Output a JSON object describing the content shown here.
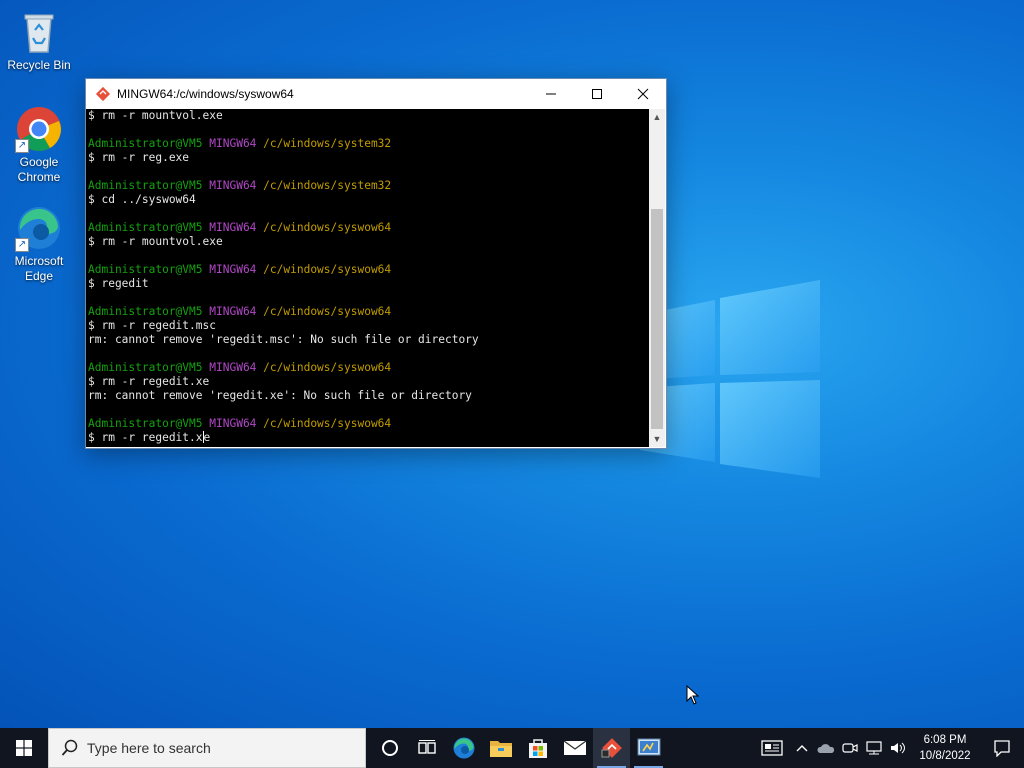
{
  "desktop": {
    "icons": [
      {
        "label": "Recycle Bin",
        "icon": "recycle-bin-icon"
      },
      {
        "label": "Google Chrome",
        "icon": "chrome-icon"
      },
      {
        "label": "Microsoft Edge",
        "icon": "edge-icon"
      }
    ]
  },
  "terminal": {
    "title": "MINGW64:/c/windows/syswow64",
    "user_host": "Administrator@VM5",
    "shell": "MINGW64",
    "lines": [
      {
        "kind": "cmd",
        "text": "$ rm -r mountvol.exe"
      },
      {
        "kind": "blank"
      },
      {
        "kind": "prompt",
        "path": "/c/windows/system32"
      },
      {
        "kind": "cmd",
        "text": "$ rm -r reg.exe"
      },
      {
        "kind": "blank"
      },
      {
        "kind": "prompt",
        "path": "/c/windows/system32"
      },
      {
        "kind": "cmd",
        "text": "$ cd ../syswow64"
      },
      {
        "kind": "blank"
      },
      {
        "kind": "prompt",
        "path": "/c/windows/syswow64"
      },
      {
        "kind": "cmd",
        "text": "$ rm -r mountvol.exe"
      },
      {
        "kind": "blank"
      },
      {
        "kind": "prompt",
        "path": "/c/windows/syswow64"
      },
      {
        "kind": "cmd",
        "text": "$ regedit"
      },
      {
        "kind": "blank"
      },
      {
        "kind": "prompt",
        "path": "/c/windows/syswow64"
      },
      {
        "kind": "cmd",
        "text": "$ rm -r regedit.msc"
      },
      {
        "kind": "out",
        "text": "rm: cannot remove 'regedit.msc': No such file or directory"
      },
      {
        "kind": "blank"
      },
      {
        "kind": "prompt",
        "path": "/c/windows/syswow64"
      },
      {
        "kind": "cmd",
        "text": "$ rm -r regedit.xe"
      },
      {
        "kind": "out",
        "text": "rm: cannot remove 'regedit.xe': No such file or directory"
      },
      {
        "kind": "blank"
      },
      {
        "kind": "prompt",
        "path": "/c/windows/syswow64"
      }
    ],
    "current_input": "$ rm -r regedit.x",
    "current_input_after_cursor": "e"
  },
  "taskbar": {
    "search_placeholder": "Type here to search",
    "apps": [
      "cortana-icon",
      "task-view-icon",
      "edge-icon",
      "file-explorer-icon",
      "store-icon",
      "mail-icon",
      "git-bash-icon",
      "control-panel-icon"
    ],
    "clock_time": "6:08 PM",
    "clock_date": "10/8/2022"
  },
  "colors": {
    "prompt_user": "#13a10e",
    "prompt_shell": "#b148c6",
    "prompt_path": "#c19c00",
    "taskbar_bg": "#101520"
  }
}
